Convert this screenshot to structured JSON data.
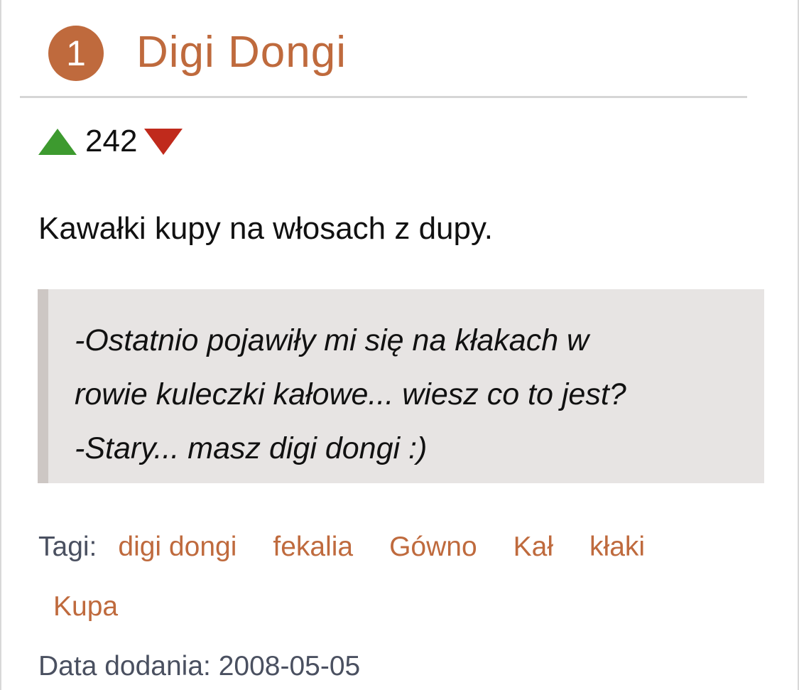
{
  "entry": {
    "rank": "1",
    "title": "Digi Dongi",
    "score": "242",
    "definition": "Kawałki kupy na włosach z dupy.",
    "example_lines": [
      "-Ostatnio pojawiły mi się na kłakach w",
      "rowie kuleczki kałowe... wiesz co to jest?",
      "-Stary... masz digi dongi :)"
    ],
    "tags_label": "Tagi:",
    "tags": [
      "digi dongi",
      "fekalia",
      "Gówno",
      "Kał",
      "kłaki",
      "Kupa"
    ],
    "date_label": "Data dodania:",
    "date": "2008-05-05"
  },
  "icons": {
    "upvote": "triangle-up-icon",
    "downvote": "triangle-down-icon"
  },
  "colors": {
    "accent": "#bf6a3d",
    "upvote": "#3d9a2f",
    "downvote": "#c02a1c",
    "example_background": "#e7e4e3",
    "example_border": "#cdc7c4",
    "muted_text": "#4a5060"
  }
}
